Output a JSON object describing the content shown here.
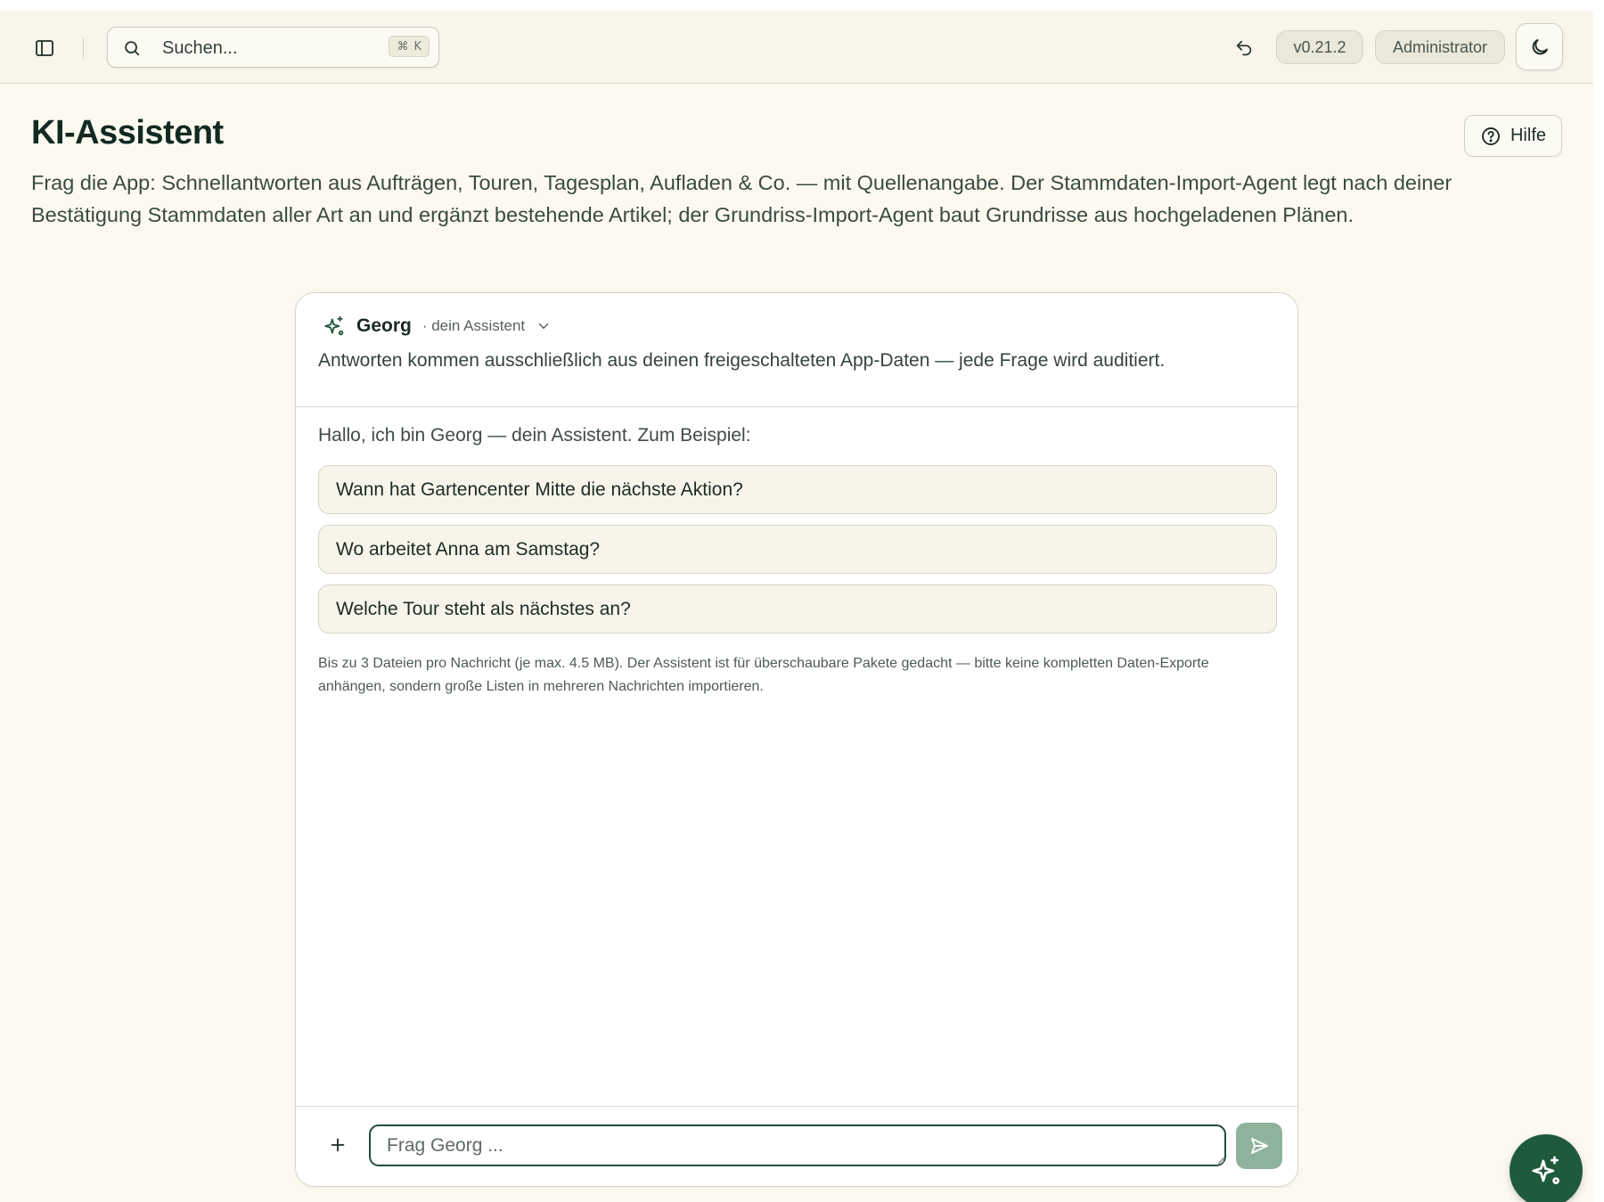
{
  "header": {
    "search_placeholder": "Suchen...",
    "search_shortcut_symbol": "⌘",
    "search_shortcut_key": "K",
    "version": "v0.21.2",
    "role": "Administrator"
  },
  "page": {
    "title": "KI-Assistent",
    "help_label": "Hilfe",
    "description": "Frag die App: Schnellantworten aus Aufträgen, Touren, Tagesplan, Aufladen & Co. — mit Quellenangabe. Der Stammdaten-Import-Agent legt nach deiner Bestätigung Stammdaten aller Art an und ergänzt bestehende Artikel; der Grundriss-Import-Agent baut Grundrisse aus hochgeladenen Plänen."
  },
  "chat": {
    "assistant_name": "Georg",
    "assistant_subtitle": "· dein Assistent",
    "note": "Antworten kommen ausschließlich aus deinen freigeschalteten App-Daten — jede Frage wird auditiert.",
    "greeting": "Hallo, ich bin Georg — dein Assistent. Zum Beispiel:",
    "suggestions": [
      "Wann hat Gartencenter Mitte die nächste Aktion?",
      "Wo arbeitet Anna am Samstag?",
      "Welche Tour steht als nächstes an?"
    ],
    "limits_note": "Bis zu 3 Dateien pro Nachricht (je max. 4.5 MB). Der Assistent ist für überschaubare Pakete gedacht — bitte keine kompletten Daten-Exporte anhängen, sondern große Listen in mehreren Nachrichten importieren.",
    "input_placeholder": "Frag Georg ..."
  },
  "colors": {
    "background": "#fcfaf0",
    "accent": "#1f5a3d",
    "send_button": "#8fb29d"
  },
  "icons": {
    "sidebar_toggle": "sidebar-panel-icon",
    "search": "search-icon",
    "undo": "undo-icon",
    "theme": "moon-icon",
    "help": "help-circle-icon",
    "assistant": "sparkle-icon",
    "dropdown": "chevron-down-icon",
    "attach": "plus-icon",
    "send": "send-icon"
  }
}
